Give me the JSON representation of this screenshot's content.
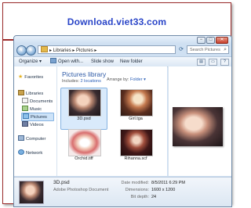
{
  "banner": {
    "text": "Download.viet33.com"
  },
  "window": {
    "caption_min": "−",
    "caption_max": "□",
    "caption_close": "✕"
  },
  "address": {
    "path": "▸ Libraries ▸ Pictures ▸",
    "search_placeholder": "Search Pictures"
  },
  "toolbar": {
    "organize": "Organize ▾",
    "open_with": "Open with...",
    "slide_show": "Slide show",
    "new_folder": "New folder"
  },
  "nav": {
    "favorites": "Favorites",
    "libraries": "Libraries",
    "documents": "Documents",
    "music": "Music",
    "pictures": "Pictures",
    "videos": "Videos",
    "computer": "Computer",
    "network": "Network"
  },
  "library": {
    "title": "Pictures library",
    "includes_label": "Includes:",
    "includes_link": "2 locations",
    "arrange_label": "Arrange by:",
    "arrange_value": "Folder ▾"
  },
  "files": [
    {
      "name": "3D.psd"
    },
    {
      "name": "Girl.tga"
    },
    {
      "name": "Orchid.tiff"
    },
    {
      "name": "Rihanna.scf"
    }
  ],
  "details": {
    "name": "3D.psd",
    "type": "Adobe Photoshop Document",
    "date_modified_label": "Date modified:",
    "date_modified": "8/5/2011 6:29 PM",
    "dimensions_label": "Dimensions:",
    "dimensions": "1600 x 1200",
    "bit_depth_label": "Bit depth:",
    "bit_depth": "24"
  }
}
